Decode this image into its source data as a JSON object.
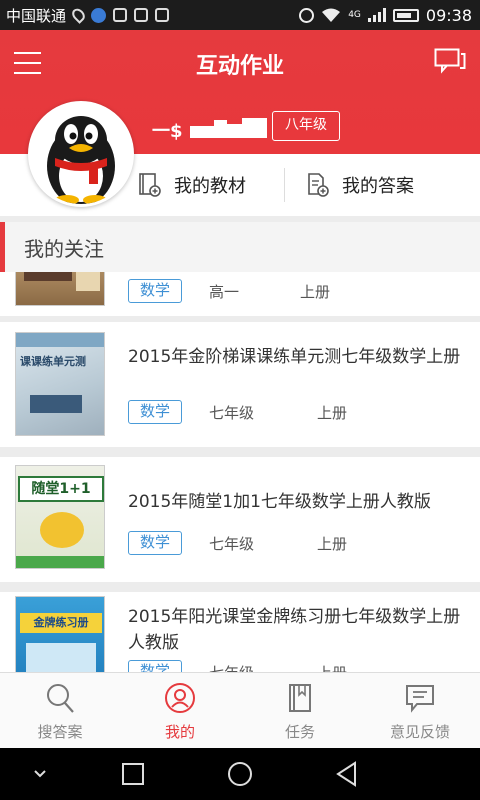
{
  "status_bar": {
    "carrier": "中国联通",
    "network": "4G",
    "time": "09:38"
  },
  "header": {
    "title": "互动作业",
    "username": "一$",
    "grade": "八年级"
  },
  "actions": [
    {
      "label": "我的教材",
      "icon": "textbook-icon"
    },
    {
      "label": "我的答案",
      "icon": "answer-sheet-icon"
    }
  ],
  "section": {
    "title": "我的关注"
  },
  "books": [
    {
      "title": "",
      "subject": "数学",
      "grade": "高一",
      "term": "上册",
      "cover_text": ""
    },
    {
      "title": "2015年金阶梯课课练单元测七年级数学上册",
      "subject": "数学",
      "grade": "七年级",
      "term": "上册",
      "cover_text": "课课练单元测"
    },
    {
      "title": "2015年随堂1加1七年级数学上册人教版",
      "subject": "数学",
      "grade": "七年级",
      "term": "上册",
      "cover_text": "随堂1+1"
    },
    {
      "title": "2015年阳光课堂金牌练习册七年级数学上册人教版",
      "subject": "数学",
      "grade": "七年级",
      "term": "上册",
      "cover_text": "金牌练习册"
    }
  ],
  "bottom_nav": [
    {
      "label": "搜答案",
      "icon": "search-icon",
      "active": false
    },
    {
      "label": "我的",
      "icon": "profile-icon",
      "active": true
    },
    {
      "label": "任务",
      "icon": "book-task-icon",
      "active": false
    },
    {
      "label": "意见反馈",
      "icon": "feedback-icon",
      "active": false
    }
  ],
  "colors": {
    "brand_red": "#e53a3e",
    "tag_blue": "#3d8fd4"
  }
}
